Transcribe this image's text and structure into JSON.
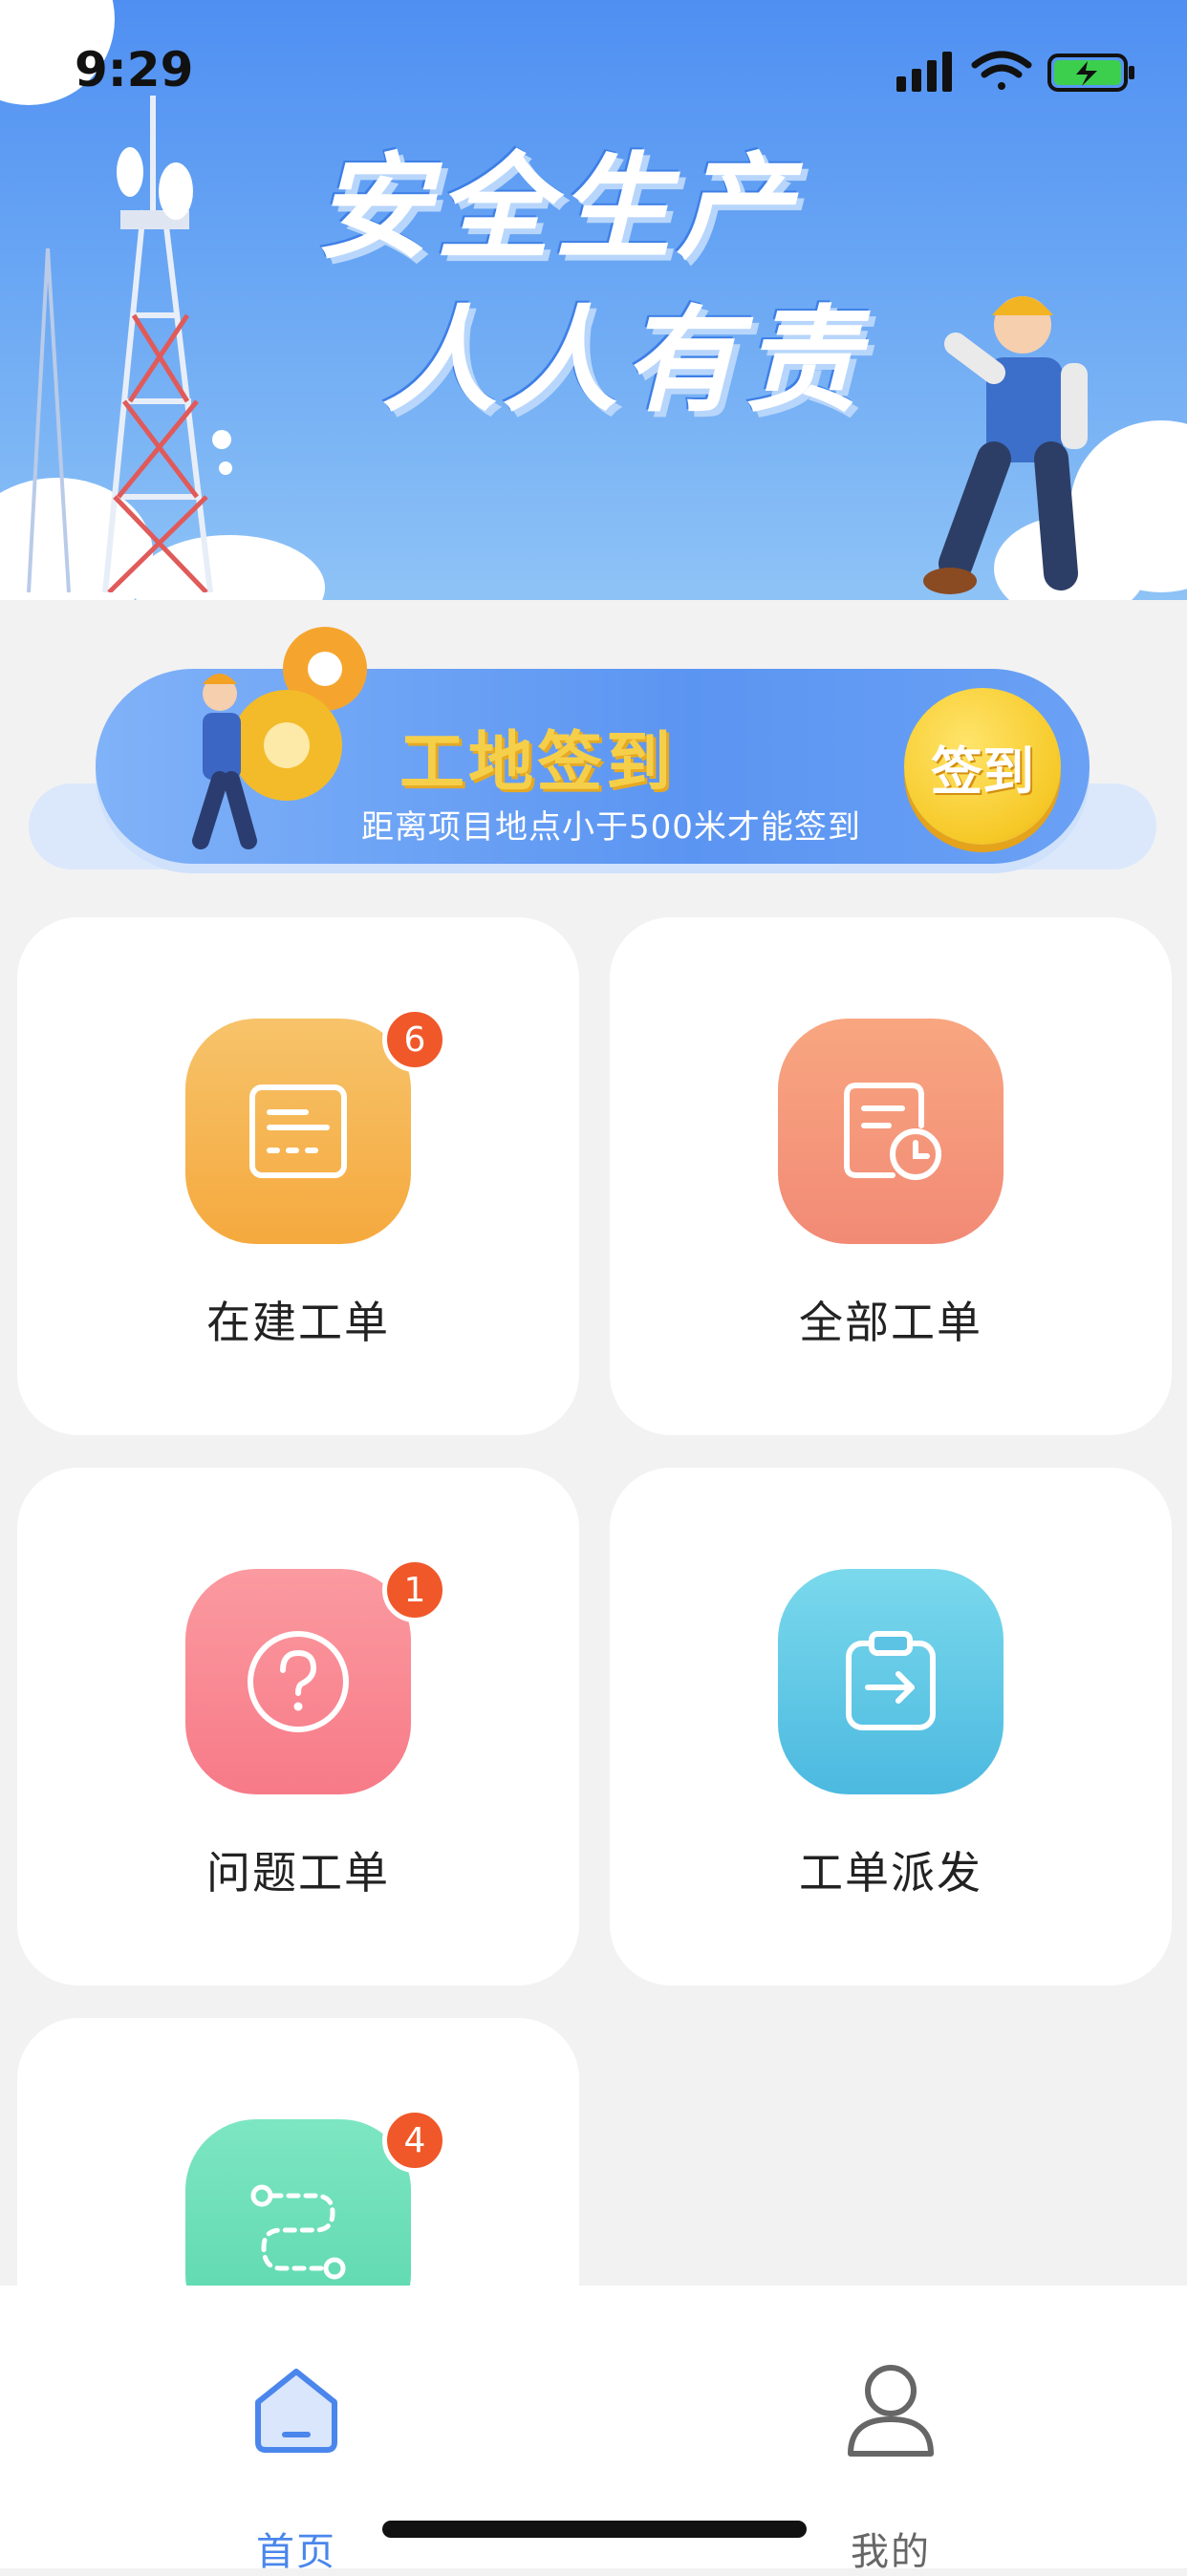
{
  "status_bar": {
    "time": "9:29"
  },
  "banner": {
    "line1": "安全生产",
    "line2": "人人有责"
  },
  "sign_in": {
    "title": "工地签到",
    "subtitle": "距离项目地点小于500米才能签到",
    "button": "签到"
  },
  "tiles": [
    {
      "label": "在建工单",
      "badge": "6",
      "icon": "document-list-icon",
      "color": "#f6b24e"
    },
    {
      "label": "全部工单",
      "badge": "",
      "icon": "document-clock-icon",
      "color": "#f38c72"
    },
    {
      "label": "问题工单",
      "badge": "1",
      "icon": "question-circle-icon",
      "color": "#f87a8a"
    },
    {
      "label": "工单派发",
      "badge": "",
      "icon": "clipboard-arrow-icon",
      "color": "#4fbfe2"
    },
    {
      "label": "",
      "badge": "4",
      "icon": "route-icon",
      "color": "#5ddbb0"
    }
  ],
  "tabbar": {
    "home": "首页",
    "mine": "我的",
    "active_color": "#4a86ec",
    "inactive_color": "#666666"
  }
}
